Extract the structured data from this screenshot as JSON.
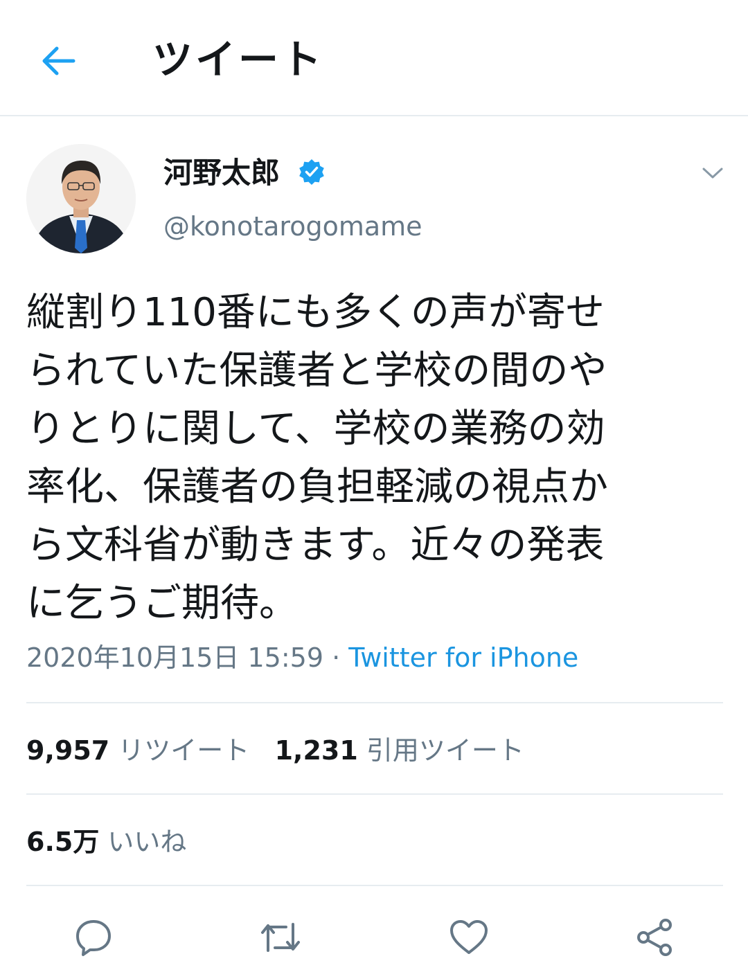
{
  "header": {
    "title": "ツイート",
    "back_icon": "arrow-left-icon",
    "accent_color": "#1da1f2"
  },
  "tweet": {
    "author": {
      "name": "河野太郎",
      "handle": "@konotarogomame",
      "verified": true
    },
    "text_lines": [
      "縦割り110番にも多くの声が寄せ",
      "られていた保護者と学校の間のや",
      "りとりに関して、学校の業務の効",
      "率化、保護者の負担軽減の視点か",
      "ら文科省が動きます。近々の発表",
      "に乞うご期待。"
    ],
    "timestamp": "2020年10月15日 15:59",
    "separator": " · ",
    "source": "Twitter for iPhone"
  },
  "stats": {
    "retweets_count": "9,957",
    "retweets_label": "リツイート",
    "quotes_count": "1,231",
    "quotes_label": "引用ツイート",
    "likes_count": "6.5万",
    "likes_label": "いいね"
  },
  "actions": {
    "reply": "reply-icon",
    "retweet": "retweet-icon",
    "like": "heart-icon",
    "share": "share-icon"
  },
  "colors": {
    "text": "#14171a",
    "secondary": "#657786",
    "link": "#1b95e0",
    "divider": "#e6ecf0"
  }
}
